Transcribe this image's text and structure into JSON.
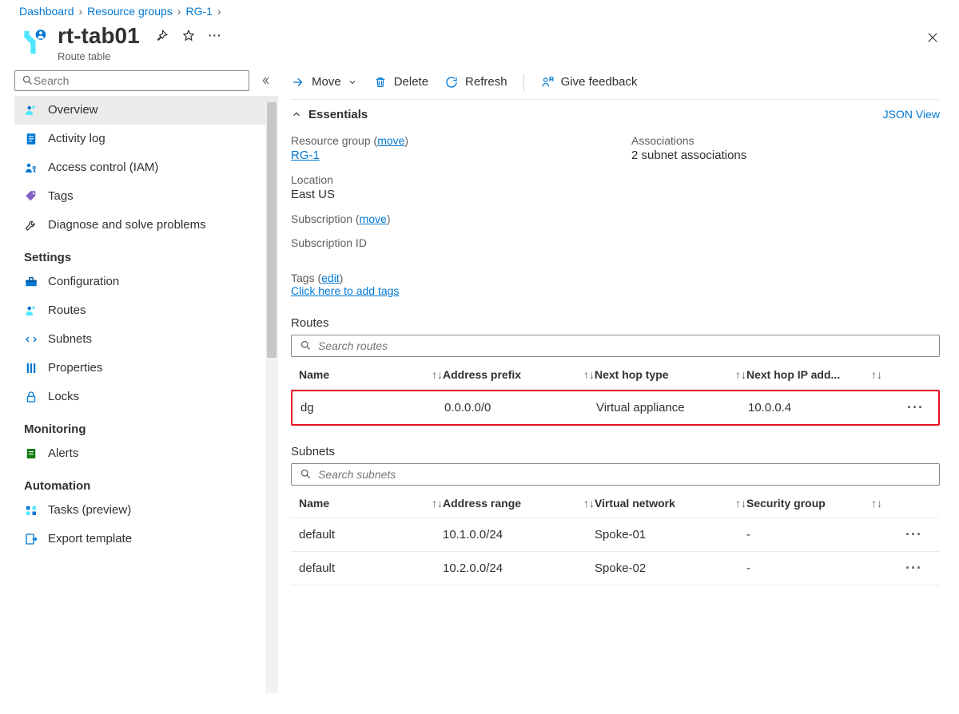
{
  "breadcrumb": [
    "Dashboard",
    "Resource groups",
    "RG-1"
  ],
  "header": {
    "title": "rt-tab01",
    "subtitle": "Route table"
  },
  "sidebar": {
    "search_placeholder": "Search",
    "items": [
      {
        "label": "Overview",
        "icon": "people-icon",
        "active": true
      },
      {
        "label": "Activity log",
        "icon": "log-icon"
      },
      {
        "label": "Access control (IAM)",
        "icon": "access-icon"
      },
      {
        "label": "Tags",
        "icon": "tag-icon"
      },
      {
        "label": "Diagnose and solve problems",
        "icon": "wrench-icon"
      }
    ],
    "settings_heading": "Settings",
    "settings": [
      {
        "label": "Configuration",
        "icon": "toolbox-icon"
      },
      {
        "label": "Routes",
        "icon": "people-icon"
      },
      {
        "label": "Subnets",
        "icon": "subnet-icon"
      },
      {
        "label": "Properties",
        "icon": "properties-icon"
      },
      {
        "label": "Locks",
        "icon": "lock-icon"
      }
    ],
    "monitoring_heading": "Monitoring",
    "monitoring": [
      {
        "label": "Alerts",
        "icon": "alerts-icon"
      }
    ],
    "automation_heading": "Automation",
    "automation": [
      {
        "label": "Tasks (preview)",
        "icon": "tasks-icon"
      },
      {
        "label": "Export template",
        "icon": "export-icon"
      }
    ]
  },
  "commands": {
    "move": "Move",
    "delete": "Delete",
    "refresh": "Refresh",
    "feedback": "Give feedback"
  },
  "essentials": {
    "header": "Essentials",
    "json_view": "JSON View",
    "rg_label": "Resource group",
    "rg_move": "move",
    "rg_value": "RG-1",
    "assoc_label": "Associations",
    "assoc_value": "2 subnet associations",
    "location_label": "Location",
    "location_value": "East US",
    "sub_label": "Subscription",
    "sub_move": "move",
    "subid_label": "Subscription ID",
    "tags_label": "Tags",
    "tags_edit": "edit",
    "tags_add": "Click here to add tags"
  },
  "routes": {
    "title": "Routes",
    "search_placeholder": "Search routes",
    "headers": [
      "Name",
      "Address prefix",
      "Next hop type",
      "Next hop IP add..."
    ],
    "rows": [
      {
        "name": "dg",
        "prefix": "0.0.0.0/0",
        "hop_type": "Virtual appliance",
        "hop_ip": "10.0.0.4",
        "highlight": true
      }
    ]
  },
  "subnets": {
    "title": "Subnets",
    "search_placeholder": "Search subnets",
    "headers": [
      "Name",
      "Address range",
      "Virtual network",
      "Security group"
    ],
    "rows": [
      {
        "name": "default",
        "range": "10.1.0.0/24",
        "vnet": "Spoke-01",
        "sg": "-"
      },
      {
        "name": "default",
        "range": "10.2.0.0/24",
        "vnet": "Spoke-02",
        "sg": "-"
      }
    ]
  }
}
